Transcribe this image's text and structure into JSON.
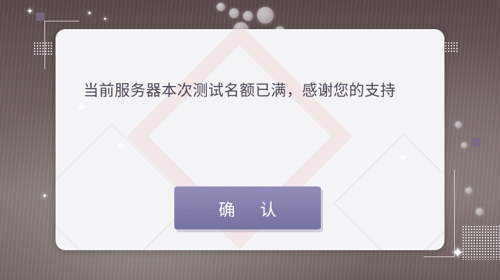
{
  "dialog": {
    "message": "当前服务器本次测试名额已满，感谢您的支持",
    "confirm_label": "确 认"
  },
  "colors": {
    "dialog_background": "#f4f3f5",
    "message_text": "#4b4555",
    "button_top": "#8c86b4",
    "button_bottom": "#6e6a9c",
    "button_text": "#ffffff"
  },
  "icons": {
    "sparkle": "sparkle-icon"
  }
}
